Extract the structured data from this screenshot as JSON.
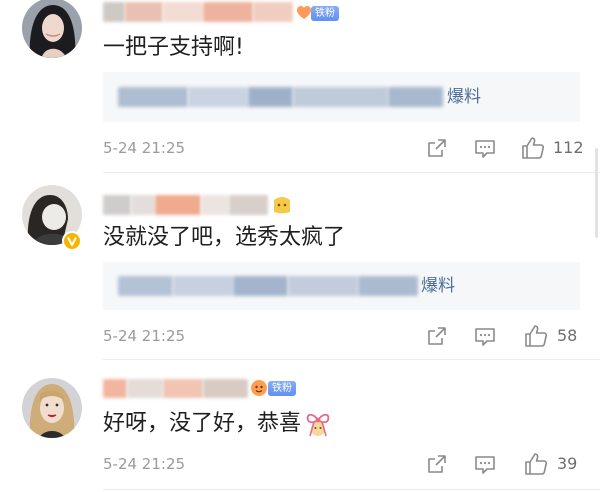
{
  "colors": {
    "text": "#1f1f1f",
    "meta": "#9b9b9b",
    "icon": "#8a8a8a",
    "reply_bg": "#f6f7f9",
    "reply_text": "#4d6f9b",
    "fan_badge": "#6f9bf5",
    "verified": "#f7b500"
  },
  "icons": {
    "share": "share-icon",
    "comment": "comment-icon",
    "like": "like-icon",
    "fan": "fan-heart-icon",
    "verified": "verified-badge-icon"
  },
  "comments": [
    {
      "author_badge": "铁粉",
      "text": "一把子支持啊!",
      "reply_preview_tail": "爆料",
      "time": "5-24 21:25",
      "like_count": "112"
    },
    {
      "verified": true,
      "text": "没就没了吧，选秀太疯了",
      "reply_preview_tail": "爆料",
      "time": "5-24 21:25",
      "like_count": "58"
    },
    {
      "author_badge": "铁粉",
      "text": "好呀，没了好，恭喜",
      "emoji": "ribbon-emoji-icon",
      "time": "5-24 21:25",
      "like_count": "39"
    }
  ]
}
